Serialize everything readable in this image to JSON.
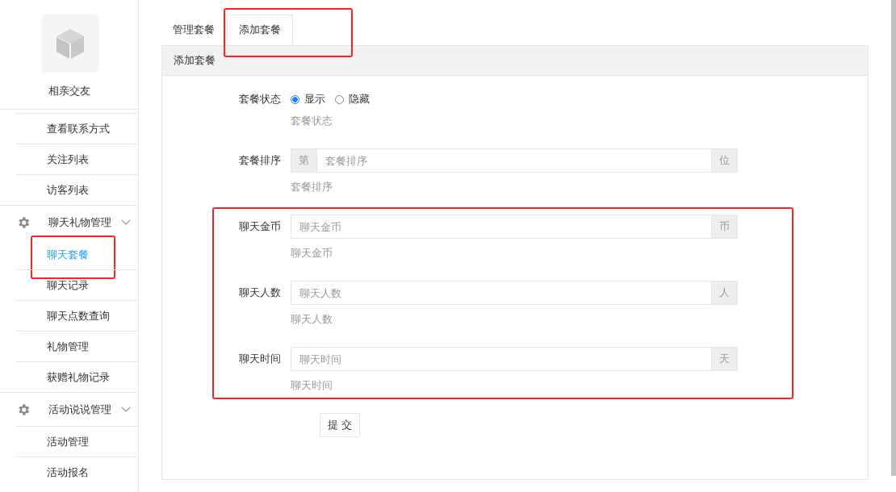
{
  "sidebar": {
    "site_name": "相亲交友",
    "items": [
      {
        "kind": "link",
        "label": "查看联系方式",
        "selected": false,
        "highlighted": false
      },
      {
        "kind": "link",
        "label": "关注列表",
        "selected": false,
        "highlighted": false
      },
      {
        "kind": "link",
        "label": "访客列表",
        "selected": false,
        "highlighted": false
      },
      {
        "kind": "group",
        "label": "聊天礼物管理",
        "expanded": true,
        "children": [
          {
            "kind": "link",
            "label": "聊天套餐",
            "selected": true,
            "highlighted": true
          },
          {
            "kind": "link",
            "label": "聊天记录",
            "selected": false,
            "highlighted": false
          },
          {
            "kind": "link",
            "label": "聊天点数查询",
            "selected": false,
            "highlighted": false
          },
          {
            "kind": "link",
            "label": "礼物管理",
            "selected": false,
            "highlighted": false
          },
          {
            "kind": "link",
            "label": "获赠礼物记录",
            "selected": false,
            "highlighted": false
          }
        ]
      },
      {
        "kind": "group",
        "label": "活动说说管理",
        "expanded": true,
        "children": [
          {
            "kind": "link",
            "label": "活动管理",
            "selected": false,
            "highlighted": false
          },
          {
            "kind": "link",
            "label": "活动报名",
            "selected": false,
            "highlighted": false
          }
        ]
      }
    ]
  },
  "tabs": [
    {
      "label": "管理套餐",
      "selected": false,
      "highlighted": false
    },
    {
      "label": "添加套餐",
      "selected": true,
      "highlighted": true
    }
  ],
  "panel": {
    "title": "添加套餐"
  },
  "form": {
    "groups": [
      {
        "highlighted": false,
        "rows": [
          {
            "kind": "radio",
            "label": "套餐状态",
            "options": [
              {
                "label": "显示",
                "selected": true
              },
              {
                "label": "隐藏",
                "selected": false
              }
            ],
            "help": "套餐状态"
          },
          {
            "kind": "input",
            "label": "套餐排序",
            "prefix": "第",
            "placeholder": "套餐排序",
            "suffix": "位",
            "help": "套餐排序"
          }
        ]
      },
      {
        "highlighted": true,
        "rows": [
          {
            "kind": "input",
            "label": "聊天金币",
            "placeholder": "聊天金币",
            "suffix": "币",
            "help": "聊天金币"
          },
          {
            "kind": "input",
            "label": "聊天人数",
            "placeholder": "聊天人数",
            "suffix": "人",
            "help": "聊天人数"
          },
          {
            "kind": "input",
            "label": "聊天时间",
            "placeholder": "聊天时间",
            "suffix": "天",
            "help": "聊天时间"
          }
        ]
      }
    ],
    "submit": "提 交"
  }
}
